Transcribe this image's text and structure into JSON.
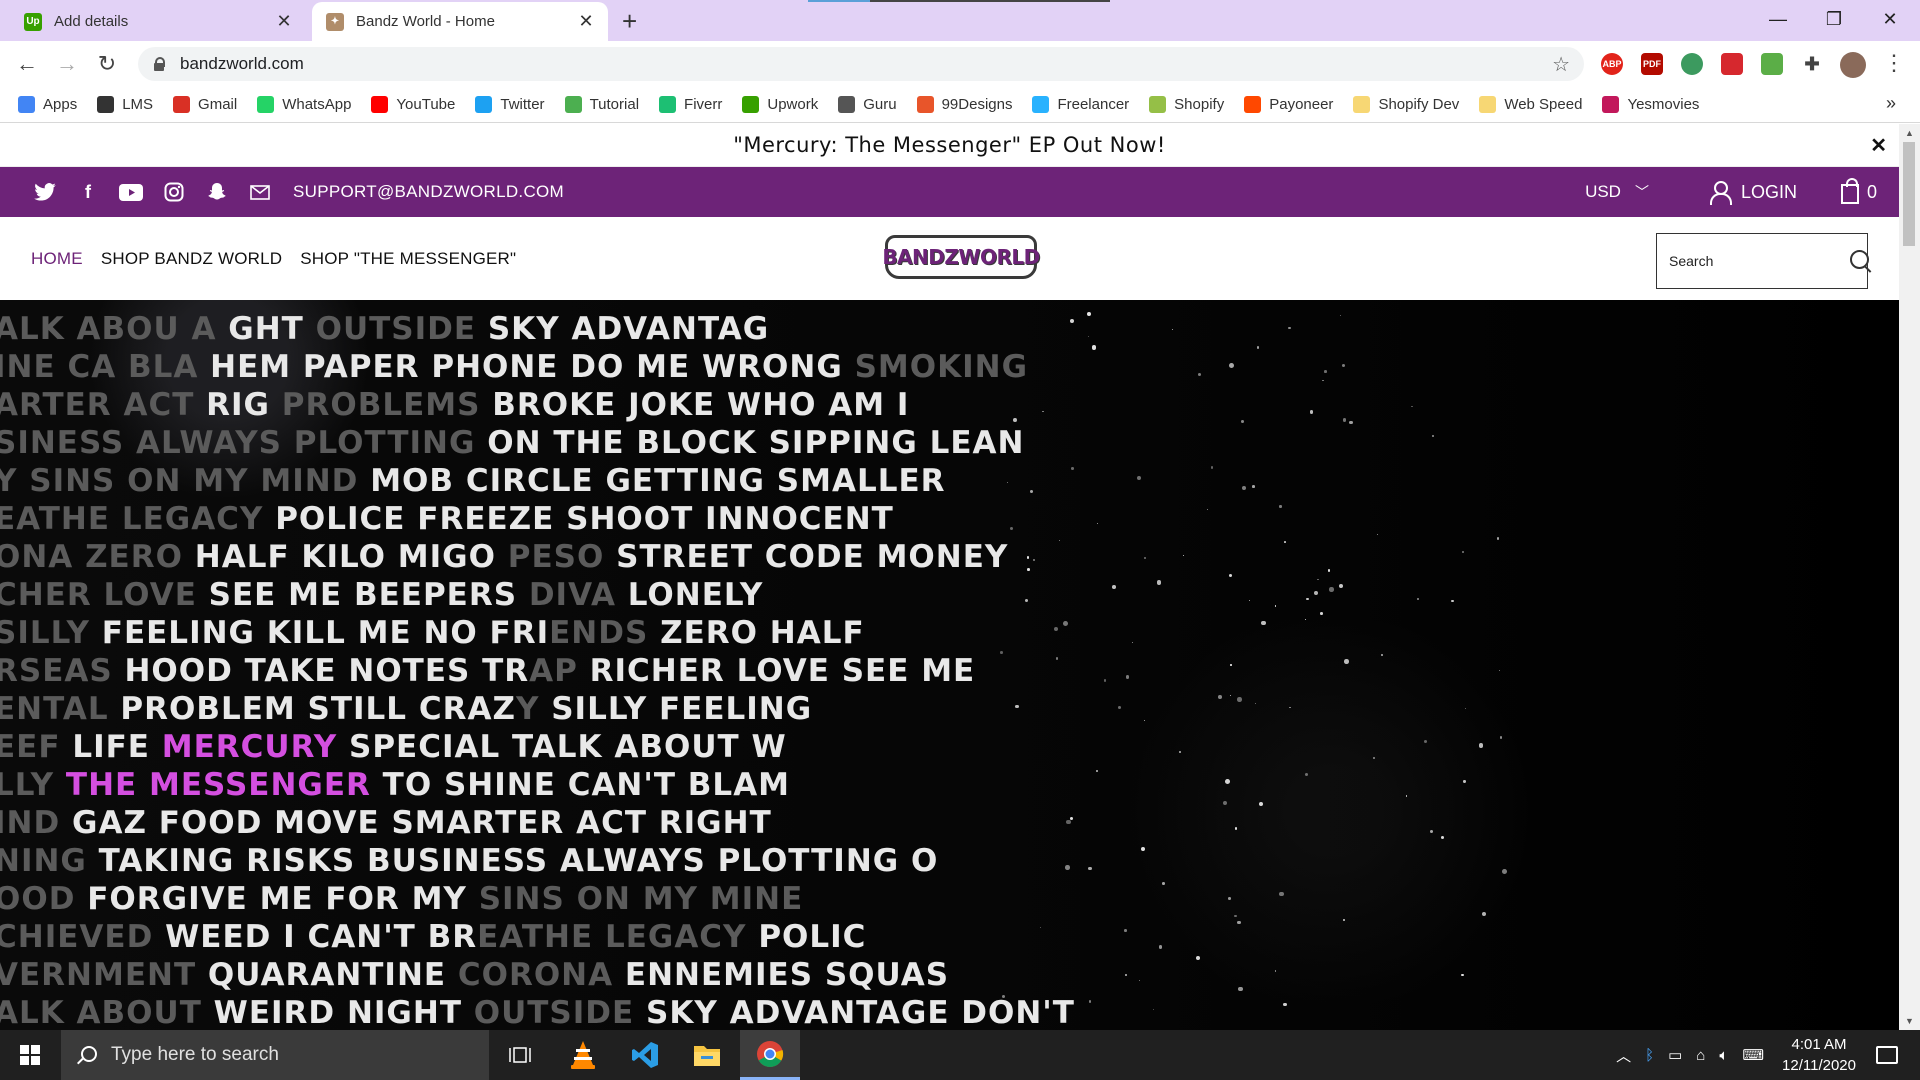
{
  "browser": {
    "tabs": [
      {
        "title": "Add details",
        "favicon": "upwork-icon"
      },
      {
        "title": "Bandz World - Home",
        "favicon": "bandzworld-icon"
      }
    ],
    "url": "bandzworld.com",
    "bookmarks": [
      {
        "label": "Apps",
        "color": "#4285f4"
      },
      {
        "label": "LMS",
        "color": "#333333"
      },
      {
        "label": "Gmail",
        "color": "#d93025"
      },
      {
        "label": "WhatsApp",
        "color": "#25d366"
      },
      {
        "label": "YouTube",
        "color": "#ff0000"
      },
      {
        "label": "Twitter",
        "color": "#1da1f2"
      },
      {
        "label": "Tutorial",
        "color": "#4caf50"
      },
      {
        "label": "Fiverr",
        "color": "#1dbf73"
      },
      {
        "label": "Upwork",
        "color": "#37a000"
      },
      {
        "label": "Guru",
        "color": "#555555"
      },
      {
        "label": "99Designs",
        "color": "#e8552a"
      },
      {
        "label": "Freelancer",
        "color": "#29b2fe"
      },
      {
        "label": "Shopify",
        "color": "#95bf47"
      },
      {
        "label": "Payoneer",
        "color": "#ff4800"
      },
      {
        "label": "Shopify Dev",
        "color": "#f7d774"
      },
      {
        "label": "Web Speed",
        "color": "#f7d774"
      },
      {
        "label": "Yesmovies",
        "color": "#c2185b"
      }
    ],
    "extensions": [
      {
        "label": "ABP",
        "color": "#e2231a"
      },
      {
        "label": "PDF",
        "color": "#b30b00"
      },
      {
        "label": "",
        "color": "#3c9a5f"
      },
      {
        "label": "",
        "color": "#d6282e"
      },
      {
        "label": "",
        "color": "#5bae47"
      }
    ]
  },
  "site": {
    "announcement": "\"Mercury: The Messenger\" EP Out Now!",
    "support_email": "SUPPORT@BANDZWORLD.COM",
    "currency": "USD",
    "login": "LOGIN",
    "cart_count": "0",
    "menu": [
      {
        "label": "HOME",
        "active": true
      },
      {
        "label": "SHOP BANDZ WORLD",
        "active": false
      },
      {
        "label": "SHOP \"THE MESSENGER\"",
        "active": false
      }
    ],
    "logo_text": "BANDZWORLD",
    "search_placeholder": "Search",
    "accent_color": "#6d2378",
    "highlight_color": "#d44fe0"
  },
  "hero": {
    "lines": [
      [
        [
          "d",
          "ALK ABOU"
        ],
        [
          "d",
          "   A    "
        ],
        [
          "w",
          "GHT "
        ],
        [
          "d",
          "OUTSIDE "
        ],
        [
          "w",
          "SKY ADVANTAG"
        ]
      ],
      [
        [
          "d",
          "INE CA  BLA   "
        ],
        [
          "w",
          "HEM PAPER PHONE DO ME WRONG "
        ],
        [
          "d",
          "SMOKING"
        ]
      ],
      [
        [
          "d",
          "ARTER ACT "
        ],
        [
          "w",
          "RIG  "
        ],
        [
          "d",
          "PROBLEMS  "
        ],
        [
          "w",
          "BROKE JOKE WHO AM I"
        ]
      ],
      [
        [
          "d",
          "SINESS ALWAYS "
        ],
        [
          "d",
          "PLOTTING "
        ],
        [
          "w",
          "ON THE BLOCK SIPPING LEAN"
        ]
      ],
      [
        [
          "d",
          "Y SINS ON MY MIND "
        ],
        [
          "w",
          "MOB CIRCLE GETTING SMALLER"
        ]
      ],
      [
        [
          "d",
          "EATHE LEGACY "
        ],
        [
          "w",
          "POLICE FREEZE SHOOT INNOCENT"
        ]
      ],
      [
        [
          "d",
          "ONA ZERO "
        ],
        [
          "w",
          "HALF KILO MIGO "
        ],
        [
          "d",
          "PESO "
        ],
        [
          "w",
          "STREET CODE MONEY"
        ]
      ],
      [
        [
          "d",
          "CHER LOVE "
        ],
        [
          "w",
          "SEE ME BEEPERS "
        ],
        [
          "d",
          "DIVA "
        ],
        [
          "w",
          "LONELY"
        ]
      ],
      [
        [
          "d",
          "SILLY "
        ],
        [
          "w",
          "FEELING KILL ME NO FRI"
        ],
        [
          "d",
          "ENDS "
        ],
        [
          "w",
          "ZERO HALF"
        ]
      ],
      [
        [
          "d",
          "RSEAS "
        ],
        [
          "w",
          "HOOD TAKE NOTES TR"
        ],
        [
          "d",
          "AP "
        ],
        [
          "w",
          "RICHER LOVE SEE ME"
        ]
      ],
      [
        [
          "d",
          "ENTAL "
        ],
        [
          "w",
          "PROBLEM STILL CRAZ"
        ],
        [
          "d",
          "Y "
        ],
        [
          "w",
          "SILLY FEELING"
        ]
      ],
      [
        [
          "d",
          "EEF "
        ],
        [
          "w",
          "LIFE "
        ],
        [
          "p",
          "MERCURY"
        ],
        [
          "w",
          " SPECIAL TALK ABOUT W"
        ]
      ],
      [
        [
          "d",
          "LLY "
        ],
        [
          "p",
          "THE MESSENGER"
        ],
        [
          "w",
          " TO SHINE CAN'T BLAM"
        ]
      ],
      [
        [
          "d",
          "IND "
        ],
        [
          "w",
          "GAZ FOOD MOVE SMARTER ACT RIGHT"
        ]
      ],
      [
        [
          "d",
          "NING "
        ],
        [
          "w",
          "TAKING RISKS BUSINESS ALWAYS PLOTTING O"
        ]
      ],
      [
        [
          "d",
          "OOD "
        ],
        [
          "w",
          "FORGIVE ME FOR MY "
        ],
        [
          "d",
          "SINS ON MY MINE"
        ]
      ],
      [
        [
          "d",
          "CHIEVED "
        ],
        [
          "w",
          "WEED I CAN'T BR"
        ],
        [
          "d",
          "EATHE LEGACY "
        ],
        [
          "w",
          "POLIC"
        ]
      ],
      [
        [
          "d",
          "VERNMENT "
        ],
        [
          "w",
          "QUARANTINE "
        ],
        [
          "d",
          "CORONA "
        ],
        [
          "w",
          "ENNEMIES SQUAS"
        ]
      ],
      [
        [
          "d",
          "ALK ABOUT "
        ],
        [
          "w",
          "WEIRD NIGHT "
        ],
        [
          "d",
          "OUTSIDE "
        ],
        [
          "w",
          "SKY ADVANTAGE DON'T"
        ]
      ]
    ]
  },
  "taskbar": {
    "search_placeholder": "Type here to search",
    "time": "4:01 AM",
    "date": "12/11/2020",
    "pinned": [
      "task-view-icon",
      "vlc-icon",
      "vscode-icon",
      "file-explorer-icon",
      "chrome-icon"
    ]
  }
}
